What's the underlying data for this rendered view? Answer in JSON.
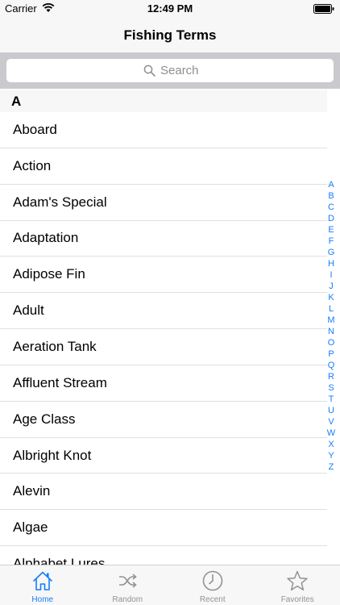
{
  "status_bar": {
    "carrier": "Carrier",
    "time": "12:49 PM"
  },
  "nav": {
    "title": "Fishing Terms"
  },
  "search": {
    "placeholder": "Search"
  },
  "section": {
    "header": "A"
  },
  "terms": [
    "Aboard",
    "Action",
    "Adam's Special",
    "Adaptation",
    "Adipose Fin",
    "Adult",
    "Aeration Tank",
    "Affluent Stream",
    "Age Class",
    "Albright Knot",
    "Alevin",
    "Algae",
    "Alphabet Lures"
  ],
  "index_letters": [
    "A",
    "B",
    "C",
    "D",
    "E",
    "F",
    "G",
    "H",
    "I",
    "J",
    "K",
    "L",
    "M",
    "N",
    "O",
    "P",
    "Q",
    "R",
    "S",
    "T",
    "U",
    "V",
    "W",
    "X",
    "Y",
    "Z"
  ],
  "tabs": [
    {
      "label": "Home",
      "icon": "home-icon",
      "active": true
    },
    {
      "label": "Random",
      "icon": "shuffle-icon",
      "active": false
    },
    {
      "label": "Recent",
      "icon": "clock-icon",
      "active": false
    },
    {
      "label": "Favorites",
      "icon": "star-icon",
      "active": false
    }
  ],
  "colors": {
    "accent": "#147efb",
    "inactive": "#929292",
    "search_bg": "#c9c9ce"
  }
}
